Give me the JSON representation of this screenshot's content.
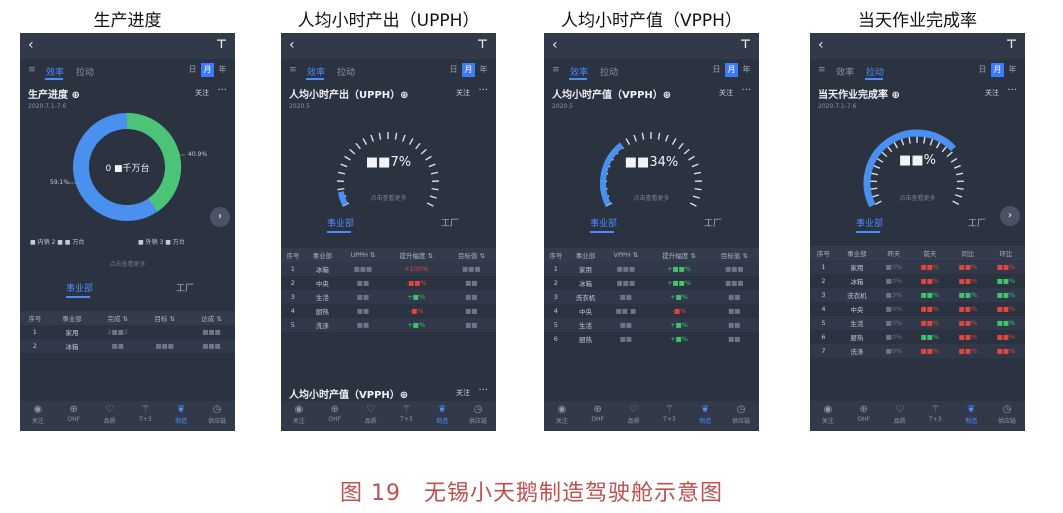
{
  "panels": [
    {
      "title": "生产进度",
      "card_title": "生产进度 ⊕",
      "card_date": "2020.7.1-7.6",
      "gauge_value": "0 ■千万台",
      "donut": {
        "left_label": "59.1%",
        "right_label": "40.9%",
        "blue_pct": 59.1,
        "green_pct": 40.9
      },
      "legend": [
        "■ 内销 2 ■ ■ 万台",
        "■ 外销 3 ■ 万台"
      ]
    },
    {
      "title": "人均小时产出（UPPH）",
      "card_title": "人均小时产出（UPPH）⊕",
      "card_date": "2020.5",
      "gauge_value": "■■7%",
      "gauge_pct": 0.07,
      "second_card": "人均小时产值（VPPH）⊕"
    },
    {
      "title": "人均小时产值（VPPH）",
      "card_title": "人均小时产值（VPPH）⊕",
      "card_date": "2020.5",
      "gauge_value": "■■34%",
      "gauge_pct": 0.34
    },
    {
      "title": "当天作业完成率",
      "card_title": "当天作业完成率 ⊕",
      "card_date": "2020.7.1-7.6",
      "gauge_value": "■■%",
      "gauge_pct": 0.7
    }
  ],
  "common": {
    "back": "‹",
    "share": "⊤",
    "menu": "≡",
    "tab_efficiency": "效率",
    "tab_pull": "拉动",
    "seg": [
      "日",
      "月",
      "年"
    ],
    "follow": "关注",
    "more": "···",
    "sub_tab_a": "事业部",
    "sub_tab_b": "工厂",
    "gauge_hint": "点击查看更多",
    "nav": [
      {
        "icon": "◉",
        "label": "关注"
      },
      {
        "icon": "⊕",
        "label": "OHF"
      },
      {
        "icon": "♡",
        "label": "品质"
      },
      {
        "icon": "⚚",
        "label": "T+3"
      },
      {
        "icon": "❦",
        "label": "制造"
      },
      {
        "icon": "◷",
        "label": "供应链"
      }
    ]
  },
  "table1": {
    "headers": [
      "序号",
      "事业部",
      "完成 ⇅",
      "目标 ⇅",
      "达成 ⇅"
    ],
    "rows": [
      [
        "1",
        "家用",
        "2■■2",
        "",
        "■■■"
      ],
      [
        "2",
        "冰箱",
        "■■",
        "■■■",
        "■■■"
      ]
    ]
  },
  "table2": {
    "headers": [
      "序号",
      "事业部",
      "UPPH ⇅",
      "提升幅度 ⇅",
      "目标值 ⇅"
    ],
    "rows": [
      [
        "1",
        "冰箱",
        "■■■",
        "+100%",
        "■■■"
      ],
      [
        "2",
        "中央",
        "■■",
        "-■■%",
        "■■"
      ],
      [
        "3",
        "生活",
        "■■",
        "+■%",
        "■■"
      ],
      [
        "4",
        "厨热",
        "■■",
        "-■%",
        "■■"
      ],
      [
        "5",
        "洗涤",
        "■■",
        "+■%",
        "■■"
      ]
    ]
  },
  "table3": {
    "headers": [
      "序号",
      "事业部",
      "VPPH ⇅",
      "提升幅度 ⇅",
      "目标值 ⇅"
    ],
    "rows": [
      [
        "1",
        "家用",
        "■■■",
        "+■■%",
        "■■■"
      ],
      [
        "2",
        "冰箱",
        "■■■",
        "+■■%",
        "■■■"
      ],
      [
        "3",
        "洗衣机",
        "■■",
        "+■%",
        "■■"
      ],
      [
        "4",
        "中央",
        "■■ ■",
        "-■%",
        "■■"
      ],
      [
        "5",
        "生活",
        "■■",
        "+■%",
        "■■"
      ],
      [
        "6",
        "厨热",
        "■■",
        "+■%",
        "■■"
      ]
    ]
  },
  "table4": {
    "headers": [
      "序号",
      "事业部",
      "昨天",
      "前天",
      "同比",
      "环比"
    ],
    "rows": [
      [
        "1",
        "家用",
        "■0%",
        "■■%",
        "■■%",
        "■■%"
      ],
      [
        "2",
        "冰箱",
        "■0%",
        "■■%",
        "■■%",
        "■■%"
      ],
      [
        "3",
        "洗衣机",
        "■3%",
        "■■%",
        "■■%",
        "■■%"
      ],
      [
        "4",
        "中央",
        "■0%",
        "■■%",
        "■■%",
        "■■%"
      ],
      [
        "5",
        "生活",
        "■0%",
        "■■%",
        "■■%",
        "■■%"
      ],
      [
        "6",
        "厨热",
        "■0%",
        "■■%",
        "■■%",
        "■■%"
      ],
      [
        "7",
        "洗涤",
        "■0%",
        "■■%",
        "■■%",
        "■■%"
      ]
    ]
  },
  "caption": "图 19　无锡小天鹅制造驾驶舱示意图"
}
